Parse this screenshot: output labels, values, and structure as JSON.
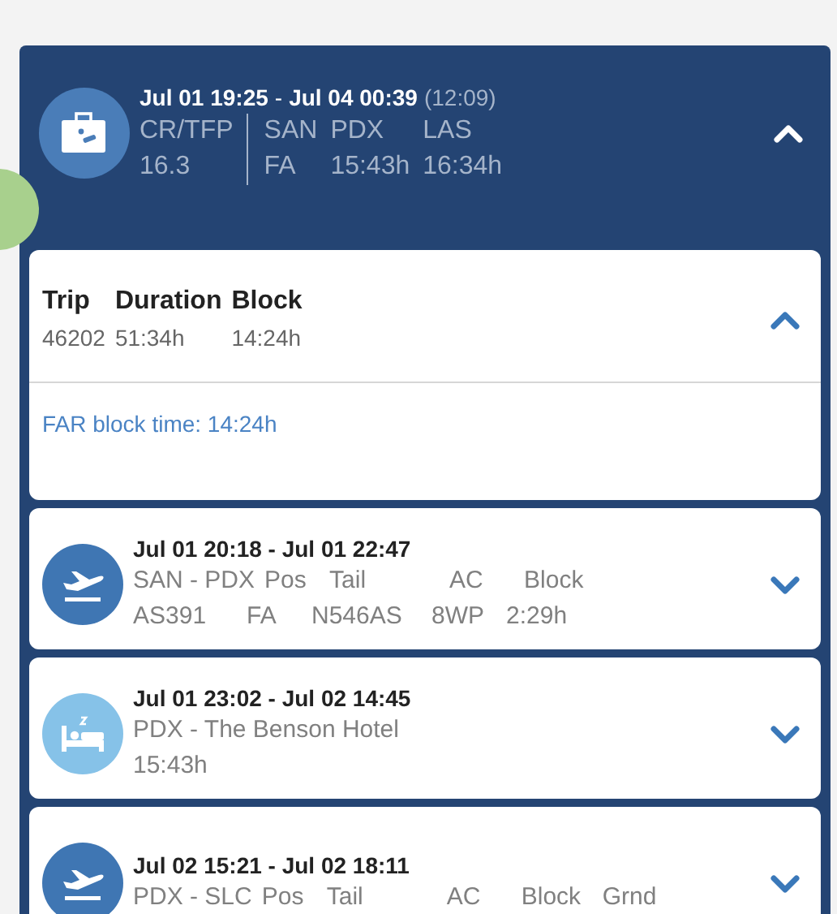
{
  "pairing": {
    "start": "Jul 01 19:25",
    "separator": "-",
    "end": "Jul 04 00:39",
    "duration": "(12:09)",
    "expanded": true,
    "stats": [
      {
        "label": "CR/TFP",
        "value": "16.3"
      }
    ],
    "columns": [
      {
        "label": "SAN",
        "value": "FA"
      },
      {
        "label": "PDX",
        "value": "15:43h"
      },
      {
        "label": "LAS",
        "value": "16:34h"
      }
    ]
  },
  "trip": {
    "expanded": true,
    "columns": [
      {
        "label": "Trip",
        "value": "46202"
      },
      {
        "label": "Duration",
        "value": "51:34h"
      },
      {
        "label": "Block",
        "value": "14:24h"
      }
    ],
    "far_block_time": "FAR block time: 14:24h"
  },
  "segments": [
    {
      "kind": "flight",
      "time": "Jul 01 20:18 - Jul 01 22:47",
      "expanded": false,
      "headers": [
        "SAN - PDX",
        "Pos",
        "Tail",
        "AC",
        "Block"
      ],
      "values": [
        "AS391",
        "FA",
        "N546AS",
        "8WP",
        "2:29h"
      ]
    },
    {
      "kind": "hotel",
      "time": "Jul 01 23:02 - Jul 02 14:45",
      "expanded": false,
      "headers": [
        "PDX - The Benson Hotel"
      ],
      "values": [
        "15:43h"
      ]
    },
    {
      "kind": "flight",
      "time": "Jul 02 15:21 - Jul 02 18:11",
      "expanded": false,
      "headers": [
        "PDX - SLC",
        "Pos",
        "Tail",
        "AC",
        "Block",
        "Grnd"
      ]
    }
  ]
}
